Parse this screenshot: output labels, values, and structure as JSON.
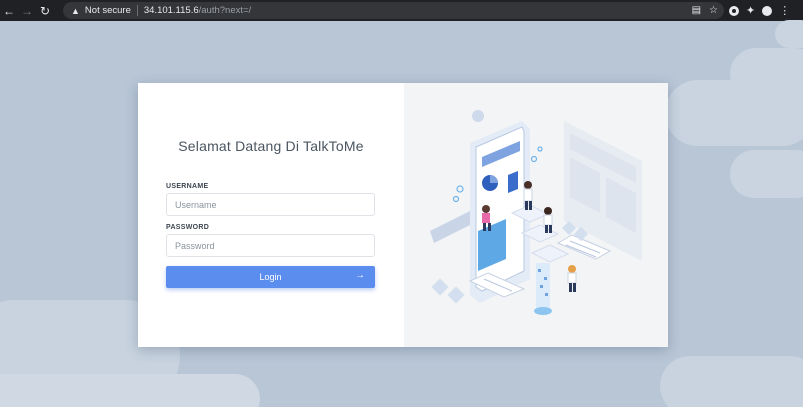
{
  "browser": {
    "not_secure": "Not secure",
    "url_host": "34.101.115.6",
    "url_path": "/auth?next=/",
    "back_icon": "arrow-left-icon",
    "forward_icon": "arrow-right-icon",
    "reload_icon": "reload-icon"
  },
  "login": {
    "title": "Selamat Datang Di TalkToMe",
    "username_label": "USERNAME",
    "username_placeholder": "Username",
    "password_label": "PASSWORD",
    "password_placeholder": "Password",
    "login_button": "Login"
  },
  "colors": {
    "accent": "#5b8def",
    "background": "#b8c6d6",
    "chrome": "#202124"
  }
}
